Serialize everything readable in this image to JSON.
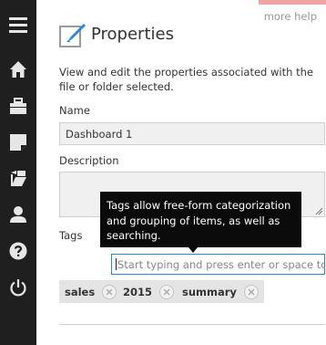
{
  "sidebar": {
    "items": [
      {
        "icon": "menu-icon"
      },
      {
        "icon": "home-icon"
      },
      {
        "icon": "briefcase-icon"
      },
      {
        "icon": "note-icon"
      },
      {
        "icon": "folder-open-icon"
      },
      {
        "icon": "user-icon"
      },
      {
        "icon": "help-icon"
      },
      {
        "icon": "power-icon"
      }
    ]
  },
  "header": {
    "more_help": "more help",
    "title": "Properties"
  },
  "description": "View and edit the properties associated with the file or folder selected.",
  "fields": {
    "name_label": "Name",
    "name_value": "Dashboard 1",
    "description_label": "Description",
    "description_value": "",
    "tags_label": "Tags",
    "tags_placeholder": "Start typing and press enter or space to add a tag"
  },
  "tooltip": "Tags allow free-form categorization and grouping of items, as well as searching.",
  "tags": [
    {
      "label": "sales"
    },
    {
      "label": "2015"
    },
    {
      "label": "summary"
    }
  ],
  "colors": {
    "sidebar": "#1f1f1f",
    "accent": "#2b88d8",
    "top_accent": "#f2a3a3"
  }
}
